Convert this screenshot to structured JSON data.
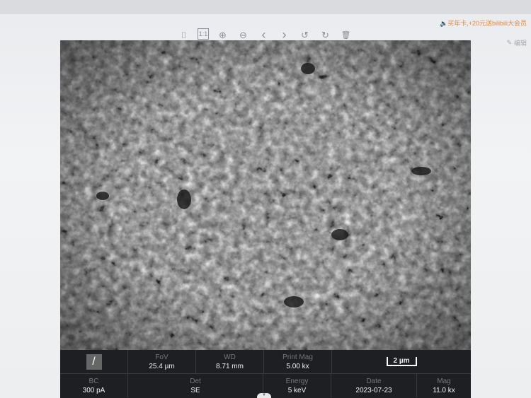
{
  "promo": {
    "icon": "speaker-icon",
    "text": "买年卡,+20元送bilibili大会员"
  },
  "toolbar": [
    {
      "name": "mouse-icon",
      "glyph": "⌷"
    },
    {
      "name": "actual-size-icon",
      "glyph": "1:1"
    },
    {
      "name": "zoom-in-icon",
      "glyph": "⊕"
    },
    {
      "name": "zoom-out-icon",
      "glyph": "⊖"
    },
    {
      "name": "previous-icon",
      "glyph": "‹"
    },
    {
      "name": "next-icon",
      "glyph": "›"
    },
    {
      "name": "rotate-left-icon",
      "glyph": "↺"
    },
    {
      "name": "rotate-right-icon",
      "glyph": "↻"
    },
    {
      "name": "delete-icon",
      "glyph": "🗑"
    }
  ],
  "edit": {
    "label": "编辑"
  },
  "info": {
    "fov": {
      "label": "FoV",
      "value": "25.4 µm"
    },
    "wd": {
      "label": "WD",
      "value": "8.71 mm"
    },
    "print_mag": {
      "label": "Print Mag",
      "value": "5.00 kx"
    },
    "scale_bar": "2 µm",
    "bc": {
      "label": "BC",
      "value": "300 pA"
    },
    "det": {
      "label": "Det",
      "value": "SE"
    },
    "energy": {
      "label": "Energy",
      "value": "5 keV"
    },
    "date": {
      "label": "Date",
      "value": "2023-07-23"
    },
    "mag": {
      "label": "Mag",
      "value": "11.0 kx"
    }
  }
}
